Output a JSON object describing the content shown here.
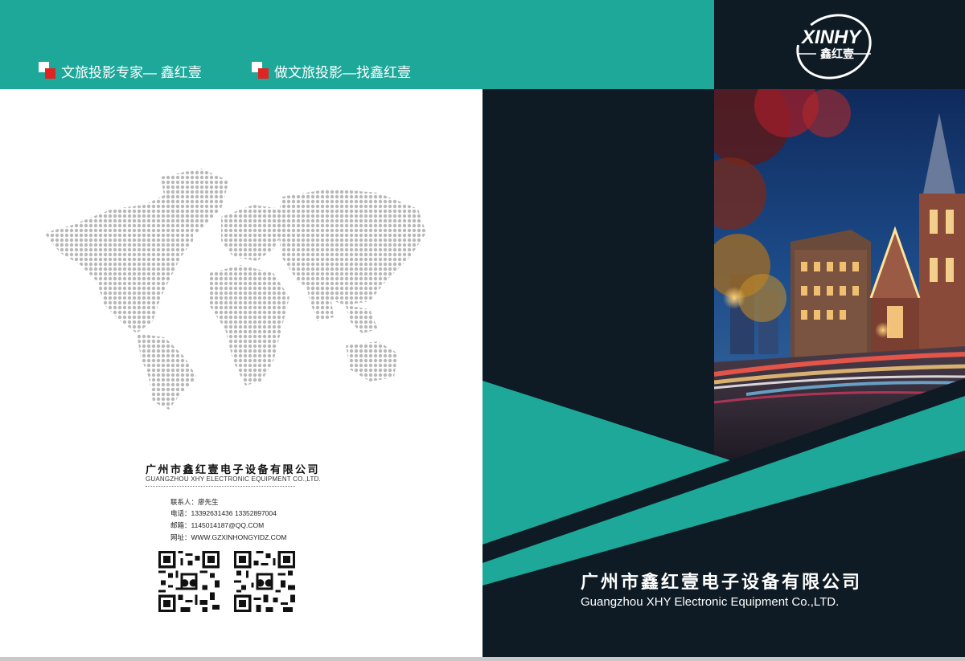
{
  "header": {
    "slogan_1": "文旅投影专家— 鑫红壹",
    "slogan_2": "做文旅投影—找鑫红壹"
  },
  "logo": {
    "latin": "XINHY",
    "chinese": "鑫红壹"
  },
  "back_cover": {
    "company_name_cn": "广州市鑫红壹电子设备有限公司",
    "company_name_en": "GUANGZHOU XHY ELECTRONIC EQUIPMENT CO.,LTD.",
    "contact_person": "联系人：廖先生",
    "phone": "电话：13392631436    13352897004",
    "email": "邮箱：1145014187@QQ.COM",
    "website": "网址：WWW.GZXINHONGYIDZ.COM"
  },
  "front_cover": {
    "title_cn": "广州市鑫红壹电子设备有限公司",
    "title_en": "Guangzhou XHY Electronic Equipment Co.,LTD."
  },
  "colors": {
    "teal": "#1ea89a",
    "dark": "#0e1b24",
    "red": "#e02424"
  }
}
